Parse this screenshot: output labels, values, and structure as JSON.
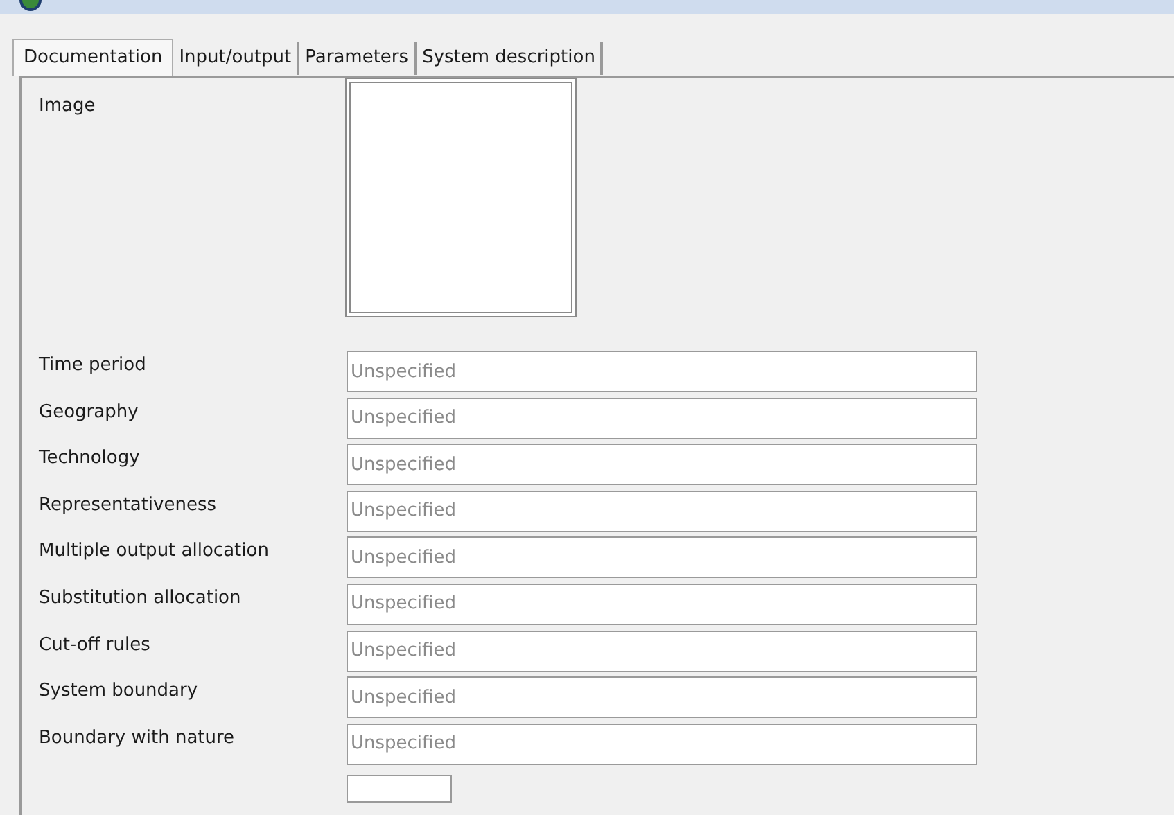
{
  "tabs": [
    {
      "label": "Documentation",
      "selected": true
    },
    {
      "label": "Input/output",
      "selected": false
    },
    {
      "label": "Parameters",
      "selected": false
    },
    {
      "label": "System description",
      "selected": false
    }
  ],
  "image": {
    "label": "Image"
  },
  "fields": [
    {
      "label": "Time period",
      "placeholder": "Unspecified"
    },
    {
      "label": "Geography",
      "placeholder": "Unspecified"
    },
    {
      "label": "Technology",
      "placeholder": "Unspecified"
    },
    {
      "label": "Representativeness",
      "placeholder": "Unspecified"
    },
    {
      "label": "Multiple output allocation",
      "placeholder": "Unspecified"
    },
    {
      "label": "Substitution allocation",
      "placeholder": "Unspecified"
    },
    {
      "label": "Cut-off rules",
      "placeholder": "Unspecified"
    },
    {
      "label": "System boundary",
      "placeholder": "Unspecified"
    },
    {
      "label": "Boundary with nature",
      "placeholder": "Unspecified"
    }
  ]
}
